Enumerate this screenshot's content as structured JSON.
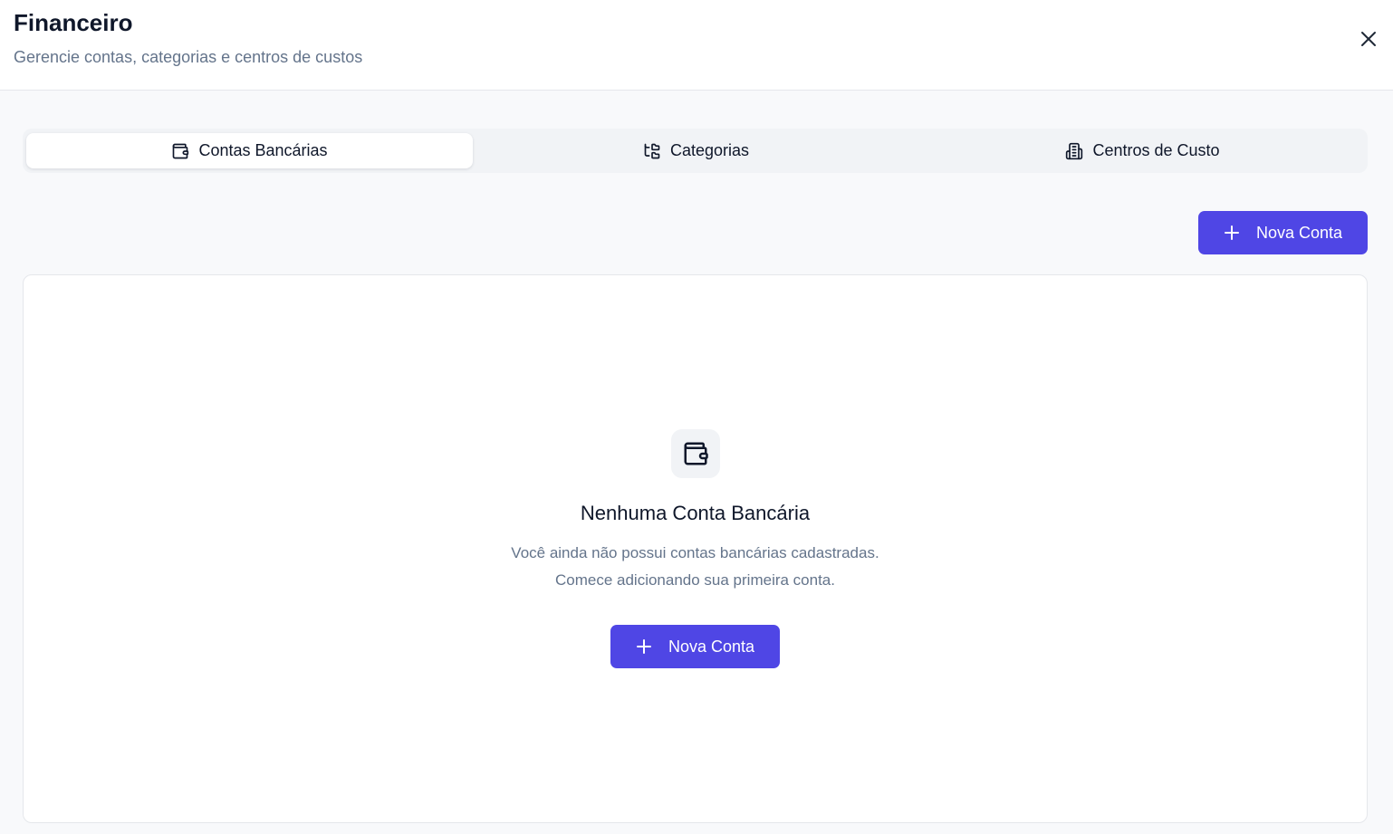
{
  "dialog": {
    "title": "Financeiro",
    "subtitle": "Gerencie contas, categorias e centros de custos",
    "close_icon": "close-icon"
  },
  "tabs": [
    {
      "label": "Contas Bancárias",
      "icon": "wallet-icon",
      "active": true
    },
    {
      "label": "Categorias",
      "icon": "tree-icon",
      "active": false
    },
    {
      "label": "Centros de Custo",
      "icon": "building-icon",
      "active": false
    }
  ],
  "toolbar": {
    "new_account_label": "Nova Conta",
    "new_account_icon": "plus-icon"
  },
  "empty_state": {
    "icon": "wallet-icon",
    "title": "Nenhuma Conta Bancária",
    "description_line1": "Você ainda não possui contas bancárias cadastradas.",
    "description_line2": "Comece adicionando sua primeira conta.",
    "button_label": "Nova Conta",
    "button_icon": "plus-icon"
  },
  "colors": {
    "accent": "#4f46e5",
    "text_primary": "#0f172a",
    "text_muted": "#64748b",
    "background": "#f8f9fb",
    "tab_track": "#f1f3f6"
  }
}
